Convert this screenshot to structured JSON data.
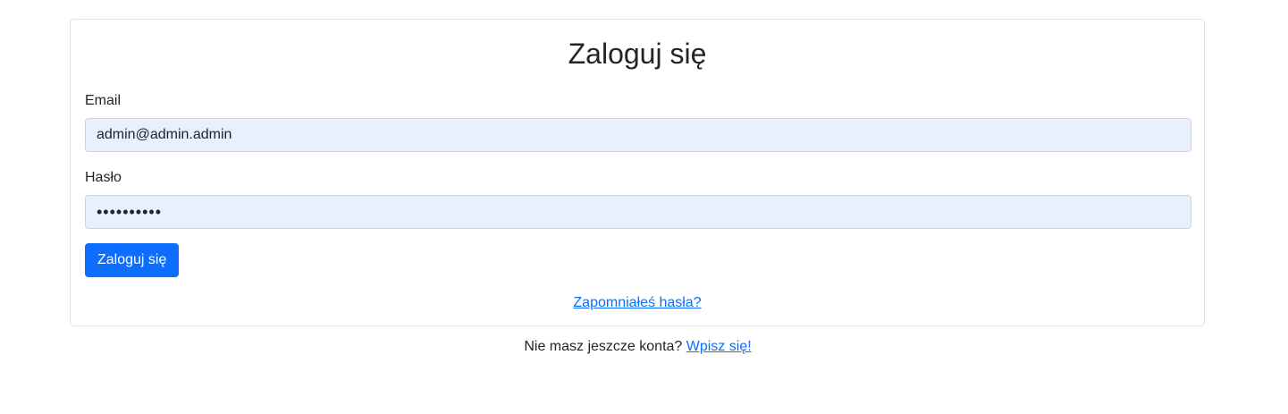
{
  "login": {
    "title": "Zaloguj się",
    "email_label": "Email",
    "email_value": "admin@admin.admin",
    "password_label": "Hasło",
    "password_value": "••••••••••",
    "submit_label": "Zaloguj się",
    "forgot_link": "Zapomniałeś hasła?"
  },
  "signup": {
    "prompt": "Nie masz jeszcze konta?",
    "link": "Wpisz się!"
  },
  "colors": {
    "primary": "#0d6efd",
    "autofill_background": "#e8f0fe",
    "text": "#212529",
    "border": "#dee2e6"
  }
}
